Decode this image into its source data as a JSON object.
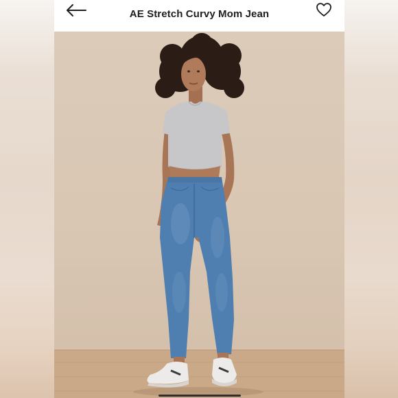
{
  "header": {
    "title": "AE Stretch Curvy Mom Jean",
    "back_icon": "arrow-left-icon",
    "favorite_icon": "heart-outline-icon"
  },
  "photo": {
    "subject": "product-photo"
  },
  "colors": {
    "background": "#ffffff",
    "text": "#1e1e1e",
    "wall": "#dccbb9",
    "floor": "#c9a987",
    "denim": "#4f7eb0"
  }
}
